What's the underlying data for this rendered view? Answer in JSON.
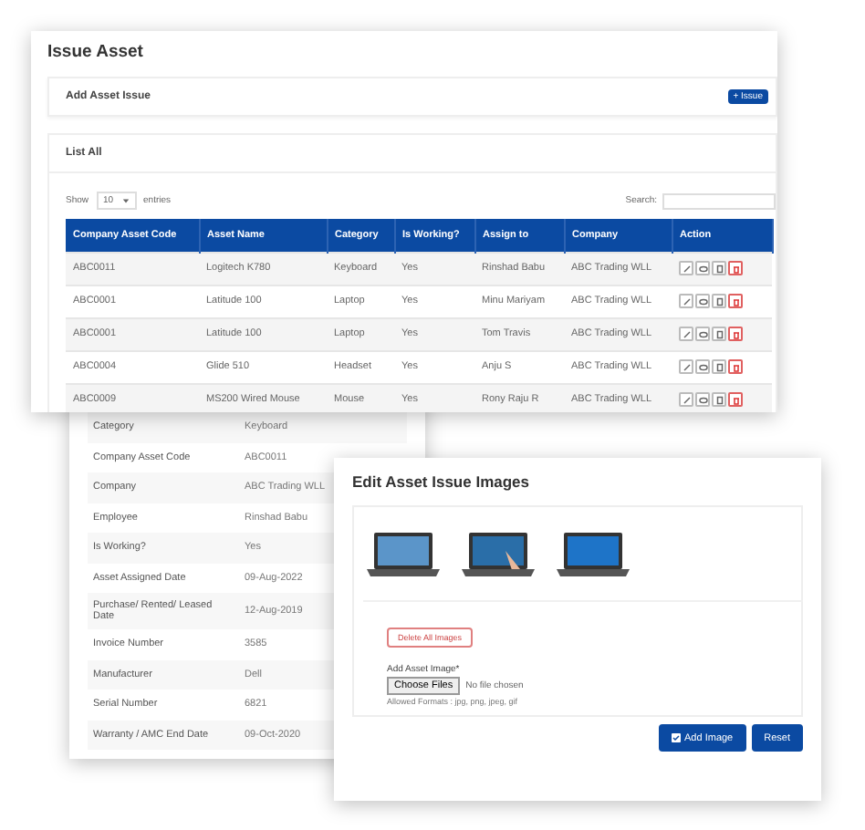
{
  "issue_window": {
    "title": "Issue Asset",
    "add_section": {
      "label": "Add Asset Issue",
      "button": "+ Issue"
    },
    "list_section": {
      "label": "List All",
      "show_label": "Show",
      "page_size": "10",
      "entries_label": "entries",
      "search_label": "Search:"
    },
    "table": {
      "columns": [
        "Company Asset Code",
        "Asset Name",
        "Category",
        "Is Working?",
        "Assign to",
        "Company",
        "Action"
      ],
      "rows": [
        {
          "cells": [
            "ABC0011",
            "Logitech K780",
            "Keyboard",
            "Yes",
            "Rinshad Babu",
            "ABC Trading WLL"
          ]
        },
        {
          "cells": [
            "ABC0001",
            "Latitude 100",
            "Laptop",
            "Yes",
            "Minu Mariyam",
            "ABC Trading WLL"
          ]
        },
        {
          "cells": [
            "ABC0001",
            "Latitude 100",
            "Laptop",
            "Yes",
            "Tom Travis",
            "ABC Trading WLL"
          ]
        },
        {
          "cells": [
            "ABC0004",
            "Glide 510",
            "Headset",
            "Yes",
            "Anju S",
            "ABC Trading WLL"
          ]
        },
        {
          "cells": [
            "ABC0009",
            "MS200 Wired Mouse",
            "Mouse",
            "Yes",
            "Rony Raju R",
            "ABC Trading WLL"
          ]
        }
      ]
    }
  },
  "details_window": {
    "rows": [
      {
        "label": "Category",
        "value": "Keyboard"
      },
      {
        "label": "Company Asset Code",
        "value": "ABC0011"
      },
      {
        "label": "Company",
        "value": "ABC Trading WLL"
      },
      {
        "label": "Employee",
        "value": "Rinshad Babu"
      },
      {
        "label": "Is Working?",
        "value": "Yes"
      },
      {
        "label": "Asset Assigned Date",
        "value": "09-Aug-2022"
      },
      {
        "label": "Purchase/ Rented/ Leased Date",
        "value": "12-Aug-2019"
      },
      {
        "label": "Invoice Number",
        "value": "3585"
      },
      {
        "label": "Manufacturer",
        "value": "Dell"
      },
      {
        "label": "Serial Number",
        "value": "6821"
      },
      {
        "label": "Warranty / AMC End Date",
        "value": "09-Oct-2020"
      }
    ]
  },
  "images_window": {
    "title": "Edit Asset Issue Images",
    "images": [
      {
        "kind": "open"
      },
      {
        "kind": "touch"
      },
      {
        "kind": "front"
      }
    ],
    "delete_button": "Delete All Images",
    "field_label": "Add Asset Image*",
    "file_button": "Choose Files",
    "file_status": "No file chosen",
    "formats_note": "Allowed Formats : jpg, png, jpeg, gif",
    "add_button": "Add Image",
    "reset_button": "Reset"
  }
}
